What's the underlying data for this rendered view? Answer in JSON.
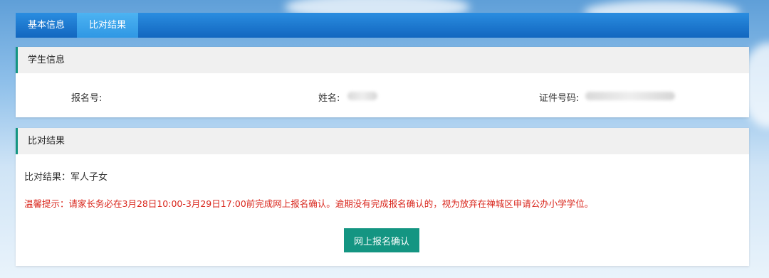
{
  "tabs": [
    {
      "label": "基本信息"
    },
    {
      "label": "比对结果"
    }
  ],
  "student_info": {
    "title": "学生信息",
    "reg_no_label": "报名号:",
    "name_label": "姓名:",
    "id_label": "证件号码:"
  },
  "compare": {
    "title": "比对结果",
    "result_text": "比对结果：军人子女",
    "tip_text": "温馨提示：请家长务必在3月28日10:00-3月29日17:00前完成网上报名确认。逾期没有完成报名确认的，视为放弃在禅城区申请公办小学学位。",
    "confirm_label": "网上报名确认"
  },
  "colors": {
    "tab_bar": "#1a76cf",
    "tab_active": "#3aa4ec",
    "accent": "#149582",
    "tip": "#d9261c"
  }
}
